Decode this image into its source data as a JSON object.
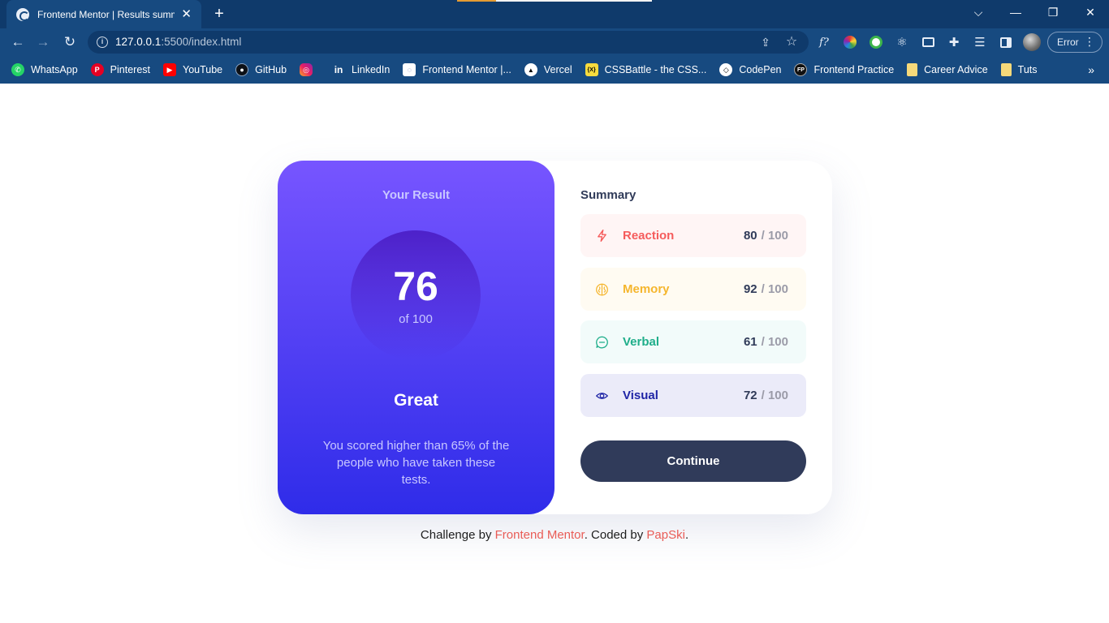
{
  "browser": {
    "tab_title": "Frontend Mentor | Results summ",
    "url_host": "127.0.0.1",
    "url_path": ":5500/index.html",
    "profile_label": "Error",
    "bookmarks": [
      {
        "label": "WhatsApp",
        "icon": "whatsapp-icon"
      },
      {
        "label": "Pinterest",
        "icon": "pinterest-icon"
      },
      {
        "label": "YouTube",
        "icon": "youtube-icon"
      },
      {
        "label": "GitHub",
        "icon": "github-icon"
      },
      {
        "label": "",
        "icon": "instagram-icon"
      },
      {
        "label": "LinkedIn",
        "icon": "linkedin-icon"
      },
      {
        "label": "Frontend Mentor |...",
        "icon": "frontend-mentor-icon"
      },
      {
        "label": "Vercel",
        "icon": "vercel-icon"
      },
      {
        "label": "CSSBattle - the CSS...",
        "icon": "cssbattle-icon"
      },
      {
        "label": "CodePen",
        "icon": "codepen-icon"
      },
      {
        "label": "Frontend Practice",
        "icon": "frontend-practice-icon"
      },
      {
        "label": "Career Advice",
        "icon": "folder-icon"
      },
      {
        "label": "Tuts",
        "icon": "folder-icon"
      }
    ]
  },
  "result": {
    "heading": "Your Result",
    "score": "76",
    "score_of": "of 100",
    "grade": "Great",
    "description": "You scored higher than 65% of the people who have taken these tests."
  },
  "summary": {
    "title": "Summary",
    "items": [
      {
        "label": "Reaction",
        "score": "80",
        "total": "/ 100",
        "color": "#f55c5c",
        "icon": "lightning-icon"
      },
      {
        "label": "Memory",
        "score": "92",
        "total": "/ 100",
        "color": "#f5b62e",
        "icon": "brain-icon"
      },
      {
        "label": "Verbal",
        "score": "61",
        "total": "/ 100",
        "color": "#1fae8a",
        "icon": "chat-bubble-icon"
      },
      {
        "label": "Visual",
        "score": "72",
        "total": "/ 100",
        "color": "#1f25a6",
        "icon": "eye-icon"
      }
    ],
    "continue_label": "Continue"
  },
  "footer": {
    "prefix": "Challenge by ",
    "link1": "Frontend Mentor",
    "middle": ". Coded by ",
    "link2": "PapSki",
    "suffix": "."
  },
  "colors": {
    "gradient_top": "#7755ff",
    "gradient_bottom": "#2f2ce9",
    "button": "#303b5a",
    "footer_link": "#e95c56",
    "browser_chrome": "#174a80"
  }
}
